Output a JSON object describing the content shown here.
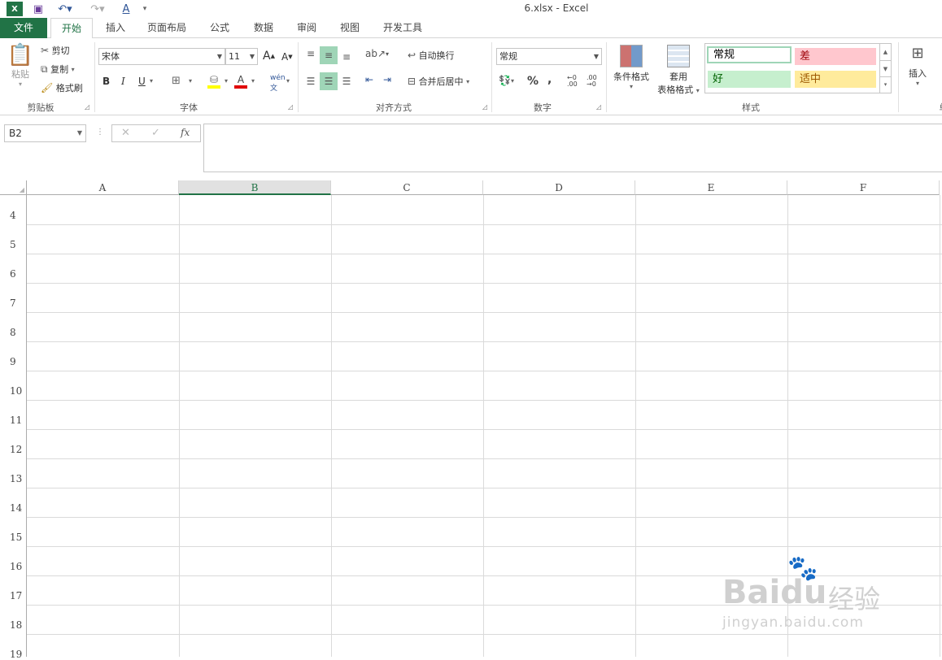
{
  "window": {
    "title": "6.xlsx - Excel"
  },
  "tabs": [
    "文件",
    "开始",
    "插入",
    "页面布局",
    "公式",
    "数据",
    "审阅",
    "视图",
    "开发工具"
  ],
  "clipboard": {
    "paste": "粘贴",
    "cut": "剪切",
    "copy": "复制",
    "format_painter": "格式刷",
    "group": "剪贴板"
  },
  "font": {
    "name": "宋体",
    "size": "11",
    "bold": "B",
    "italic": "I",
    "underline": "U",
    "group": "字体",
    "grow": "A",
    "shrink": "A"
  },
  "alignment": {
    "wrap": "自动换行",
    "merge": "合并后居中",
    "group": "对齐方式"
  },
  "number": {
    "format": "常规",
    "percent": "%",
    "comma": ",",
    "group": "数字"
  },
  "styles": {
    "conditional": "条件格式",
    "table_top": "套用",
    "table_bottom": "表格格式",
    "normal": "常规",
    "bad": "差",
    "good": "好",
    "neutral": "适中",
    "group": "样式"
  },
  "cells": {
    "insert": "插入",
    "group_partial": "单"
  },
  "formula_bar": {
    "name_box": "B2",
    "fx": "fx",
    "cancel": "✕",
    "enter": "✓",
    "value": ""
  },
  "grid": {
    "columns": [
      "A",
      "B",
      "C",
      "D",
      "E",
      "F"
    ],
    "selected_column": "B",
    "rows": [
      "4",
      "5",
      "6",
      "7",
      "8",
      "9",
      "10",
      "11",
      "12",
      "13",
      "14",
      "15",
      "16",
      "17",
      "18",
      "19"
    ]
  },
  "watermark": {
    "brand": "Bai",
    "brand2": "du",
    "cn": "经验",
    "url": "jingyan.baidu.com"
  },
  "colors": {
    "accent": "#217346",
    "bad_bg": "#ffc7ce",
    "bad_fg": "#9c0006",
    "good_bg": "#c6efce",
    "good_fg": "#006100",
    "neutral_bg": "#ffeb9c",
    "neutral_fg": "#9c5700"
  }
}
